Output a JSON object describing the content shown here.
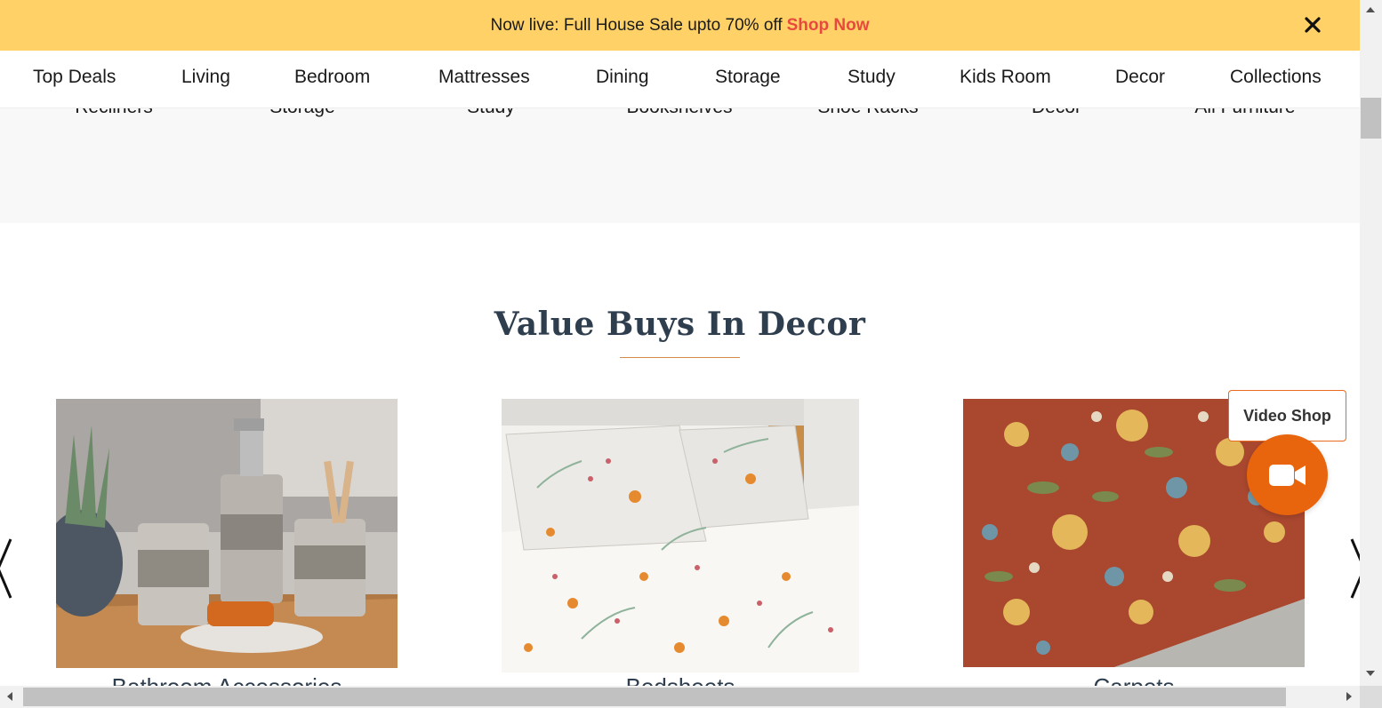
{
  "promo": {
    "text": "Now live: Full House Sale upto 70% off",
    "cta": "Shop Now",
    "background_color": "#ffd166",
    "cta_color": "#e8493d",
    "close_icon": "close-icon"
  },
  "nav": {
    "items": [
      "Top Deals",
      "Living",
      "Bedroom",
      "Mattresses",
      "Dining",
      "Storage",
      "Study",
      "Kids Room",
      "Decor",
      "Collections"
    ]
  },
  "subcategories": {
    "items": [
      "Recliners",
      "Storage",
      "Study",
      "Bookshelves",
      "Shoe Racks",
      "Decor",
      "All Furniture"
    ]
  },
  "section": {
    "title": "Value Buys In Decor",
    "underline_color": "#d58a4c"
  },
  "products": [
    {
      "label": "Bathroom Accessories",
      "image": "bathroom-accessories-photo"
    },
    {
      "label": "Bedsheets",
      "image": "floral-bedsheet-photo"
    },
    {
      "label": "Carpets",
      "image": "floral-carpet-photo"
    }
  ],
  "carousel": {
    "prev_icon": "chevron-left-icon",
    "next_icon": "chevron-right-icon"
  },
  "video_shop": {
    "label": "Video Shop",
    "icon": "video-camera-icon",
    "color": "#e8650d"
  }
}
